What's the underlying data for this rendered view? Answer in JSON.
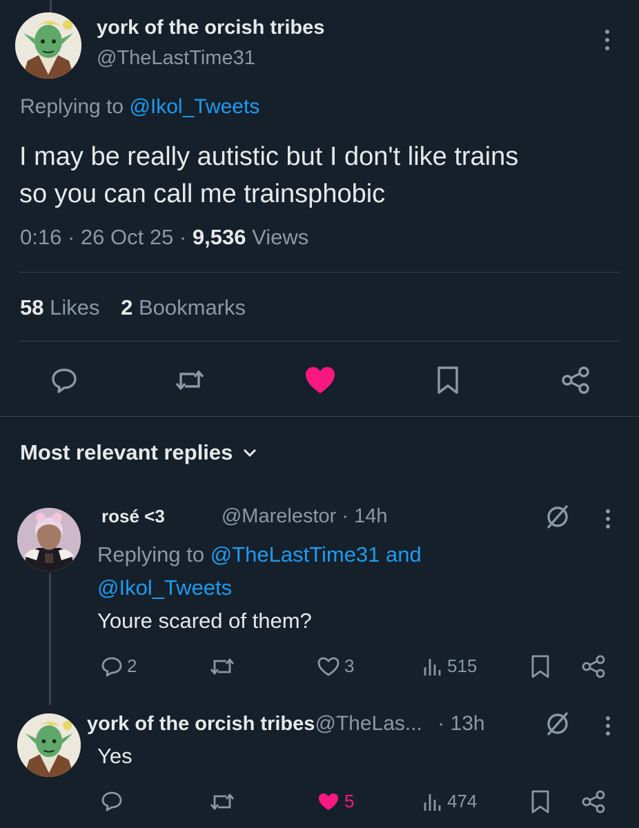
{
  "main_tweet": {
    "display_name": "york of the orcish tribes",
    "handle": "@TheLastTime31",
    "replying_prefix": "Replying to",
    "replying_to": "@Ikol_Tweets",
    "text_line1": "I may be really autistic but I don't like trains",
    "text_line2": "so you can call me trainsphobic",
    "time": "0:16",
    "date": "26 Oct 25",
    "views_count": "9,536",
    "views_label": "Views",
    "likes_count": "58",
    "likes_label": "Likes",
    "bookmarks_count": "2",
    "bookmarks_label": "Bookmarks",
    "liked": true
  },
  "replies_header": {
    "label": "Most relevant replies"
  },
  "replies": [
    {
      "display_name": "rosé <3",
      "handle": "@Marelestor",
      "time": "· 14h",
      "replying_prefix": "Replying to",
      "replying_to_1": "@TheLastTime31",
      "replying_and": "and",
      "replying_to_2": "@Ikol_Tweets",
      "text": "Youre scared of them?",
      "reply_count": "2",
      "like_count": "3",
      "views": "515"
    },
    {
      "display_name": "york of the orcish tribes",
      "handle": "@TheLas...",
      "time": "· 13h",
      "text": "Yes",
      "like_count": "5",
      "views": "474",
      "liked": true
    }
  ],
  "colors": {
    "background": "#15202b",
    "text": "#e7e9ea",
    "muted": "#8b98a5",
    "link": "#1d9bf0",
    "like": "#f91880",
    "divider": "#38444d"
  },
  "icons": [
    "more-icon",
    "reply-icon",
    "retweet-icon",
    "heart-icon",
    "bookmark-icon",
    "share-icon",
    "grok-icon",
    "views-icon",
    "chevron-down-icon"
  ]
}
